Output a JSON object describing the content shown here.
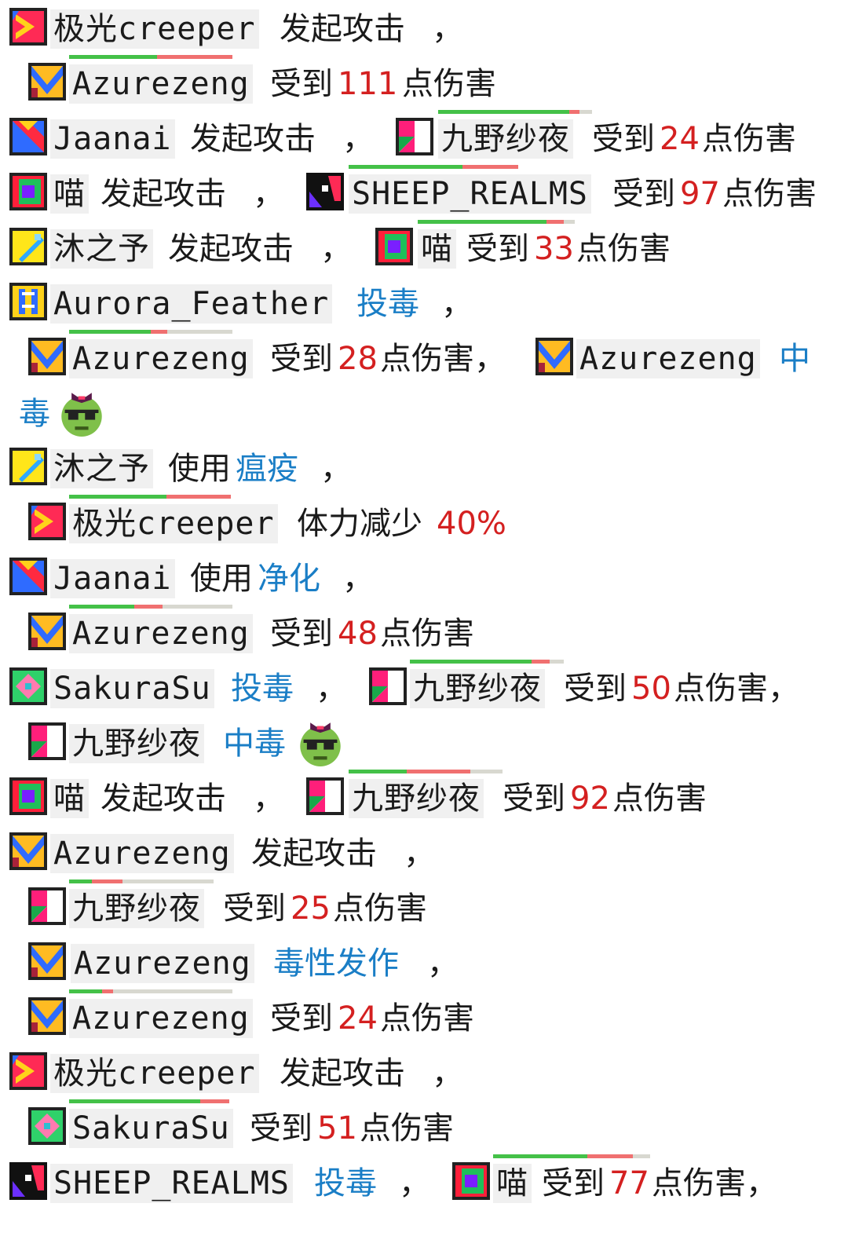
{
  "log": [
    {
      "attacker": "极光creeper",
      "action": "发起攻击",
      "sep": "，"
    },
    {
      "target": "Azurezeng",
      "prefix": "受到",
      "value": "111",
      "suffix": "点伤害",
      "hp": {
        "green": 0.54,
        "red": 0.46
      }
    },
    {
      "attacker": "Jaanai",
      "action": "发起攻击",
      "sep": "，",
      "target": "九野纱夜",
      "prefix": "受到",
      "value": "24",
      "suffix": "点伤害",
      "hp": {
        "green": 0.85,
        "red": 0.07
      }
    },
    {
      "attacker": "喵",
      "action": "发起攻击",
      "sep": "，",
      "target": "SHEEP_REALMS",
      "prefix": "受到",
      "value": "97",
      "suffix": "点伤害",
      "hp": {
        "green": 0.67,
        "red": 0.33
      }
    },
    {
      "attacker": "沐之予",
      "action": "发起攻击",
      "sep": "，",
      "target": "喵",
      "prefix": "受到",
      "value": "33",
      "suffix": "点伤害",
      "hp": {
        "green": 0.82,
        "red": 0.11
      }
    },
    {
      "attacker": "Aurora_Feather",
      "action": "投毒",
      "sep": "，"
    },
    {
      "target": "Azurezeng",
      "prefix": "受到",
      "value": "28",
      "suffix": "点伤害，",
      "hp": {
        "green": 0.5,
        "red": 0.1
      },
      "status_target": "Azurezeng",
      "status": "中"
    },
    {
      "status_tail": "毒"
    },
    {
      "attacker": "沐之予",
      "action": "使用",
      "skill": "瘟疫",
      "sep": "，"
    },
    {
      "target": "极光creeper",
      "prefix": "体力减少",
      "value": "40%",
      "hp": {
        "green": 0.6,
        "red": 0.4
      }
    },
    {
      "attacker": "Jaanai",
      "action": "使用",
      "skill": "净化",
      "sep": "，"
    },
    {
      "target": "Azurezeng",
      "prefix": "受到",
      "value": "48",
      "suffix": "点伤害",
      "hp": {
        "green": 0.4,
        "red": 0.17
      }
    },
    {
      "attacker": "SakuraSu",
      "action": "投毒",
      "sep": "，",
      "target": "九野纱夜",
      "prefix": "受到",
      "value": "50",
      "suffix": "点伤害，",
      "hp": {
        "green": 0.79,
        "red": 0.12
      }
    },
    {
      "status_target": "九野纱夜",
      "status": "中毒"
    },
    {
      "attacker": "喵",
      "action": "发起攻击",
      "sep": "，",
      "target": "九野纱夜",
      "prefix": "受到",
      "value": "92",
      "suffix": "点伤害",
      "hp": {
        "green": 0.38,
        "red": 0.41
      }
    },
    {
      "attacker": "Azurezeng",
      "action": "发起攻击",
      "sep": "，"
    },
    {
      "target": "九野纱夜",
      "prefix": "受到",
      "value": "25",
      "suffix": "点伤害",
      "hp": {
        "green": 0.16,
        "red": 0.21
      }
    },
    {
      "target": "Azurezeng",
      "skill": "毒性发作",
      "sep": "，"
    },
    {
      "target": "Azurezeng",
      "prefix": "受到",
      "value": "24",
      "suffix": "点伤害",
      "hp": {
        "green": 0.2,
        "red": 0.07
      }
    },
    {
      "attacker": "极光creeper",
      "action": "发起攻击",
      "sep": "，"
    },
    {
      "target": "SakuraSu",
      "prefix": "受到",
      "value": "51",
      "suffix": "点伤害",
      "hp": {
        "green": 0.82,
        "red": 0.18
      }
    },
    {
      "attacker": "SHEEP_REALMS",
      "action": "投毒",
      "sep": "，",
      "target": "喵",
      "prefix": "受到",
      "value": "77",
      "suffix": "点伤害，",
      "hp": {
        "green": 0.6,
        "red": 0.29
      }
    }
  ],
  "colors": {
    "damage": "#d42020",
    "skill": "#1a7ec6",
    "hp_green": "#44c148",
    "hp_red": "#f07070",
    "hp_empty": "#d8d8d0",
    "name_bg": "#f0f0f0"
  },
  "icons": {
    "极光creeper": "aurora-creeper-avatar-icon",
    "Azurezeng": "azurezeng-avatar-icon",
    "Jaanai": "jaanai-avatar-icon",
    "九野纱夜": "kuno-sayo-avatar-icon",
    "喵": "miao-avatar-icon",
    "SHEEP_REALMS": "sheep-realms-avatar-icon",
    "沐之予": "muzhiyu-avatar-icon",
    "Aurora_Feather": "aurora-feather-avatar-icon",
    "SakuraSu": "sakurasu-avatar-icon",
    "poison": "poisoned-face-emoji-icon"
  }
}
